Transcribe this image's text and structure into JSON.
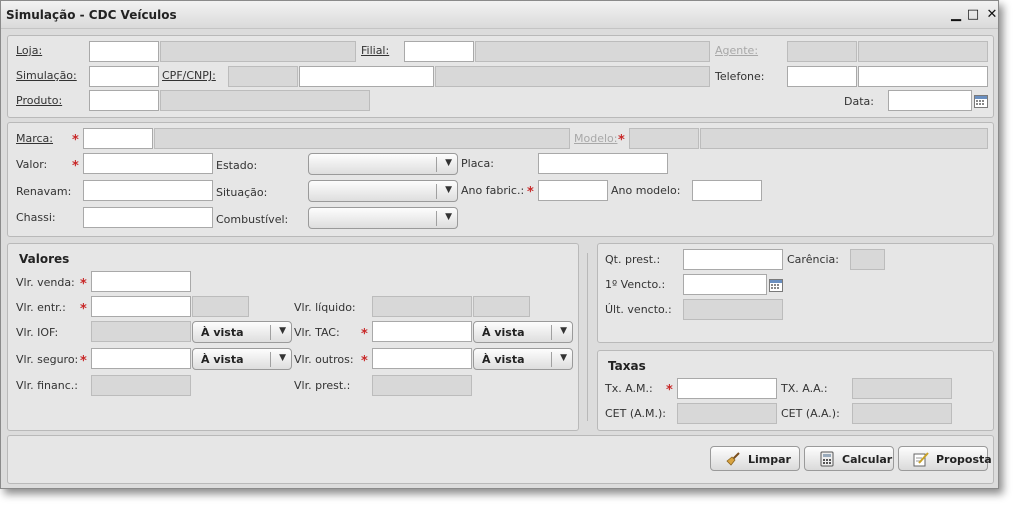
{
  "window": {
    "title": "Simulação - CDC Veículos",
    "minimize": "▁",
    "maximize": "□",
    "close": "✕"
  },
  "header": {
    "loja": "Loja:",
    "filial": "Filial:",
    "agente": "Agente:",
    "simulacao": "Simulação:",
    "cpf_cnpj": "CPF/CNPJ:",
    "telefone": "Telefone:",
    "produto": "Produto:",
    "data": "Data:"
  },
  "veiculo": {
    "marca": "Marca:",
    "modelo": "Modelo:",
    "valor": "Valor:",
    "estado": "Estado:",
    "placa": "Placa:",
    "renavam": "Renavam:",
    "situacao": "Situação:",
    "ano_fabric": "Ano fabric.:",
    "ano_modelo": "Ano modelo:",
    "chassi": "Chassi:",
    "combustivel": "Combustível:"
  },
  "valores": {
    "title": "Valores",
    "vlr_venda": "Vlr. venda:",
    "vlr_entr": "Vlr. entr.:",
    "vlr_liquido": "Vlr. líquido:",
    "vlr_iof": "Vlr. IOF:",
    "vlr_tac": "Vlr. TAC:",
    "vlr_seguro": "Vlr. seguro:",
    "vlr_outros": "Vlr. outros:",
    "vlr_financ": "Vlr. financ.:",
    "vlr_prest": "Vlr. prest.:",
    "a_vista": "À vista"
  },
  "prestacoes": {
    "qt_prest": "Qt. prest.:",
    "carencia": "Carência:",
    "primeiro_vencto": "1º Vencto.:",
    "ult_vencto": "Últ. vencto.:"
  },
  "taxas": {
    "title": "Taxas",
    "tx_am": "Tx. A.M.:",
    "tx_aa": "TX. A.A.:",
    "cet_am": "CET (A.M.):",
    "cet_aa": "CET (A.A.):"
  },
  "actions": {
    "limpar": "Limpar",
    "calcular": "Calcular",
    "proposta": "Proposta"
  },
  "colors": {
    "required": "#c82828",
    "panel": "#e6e6e6",
    "readonly": "#d8d8d8"
  },
  "icons": [
    "broom-icon",
    "calculator-icon",
    "document-pen-icon",
    "calendar-icon"
  ]
}
